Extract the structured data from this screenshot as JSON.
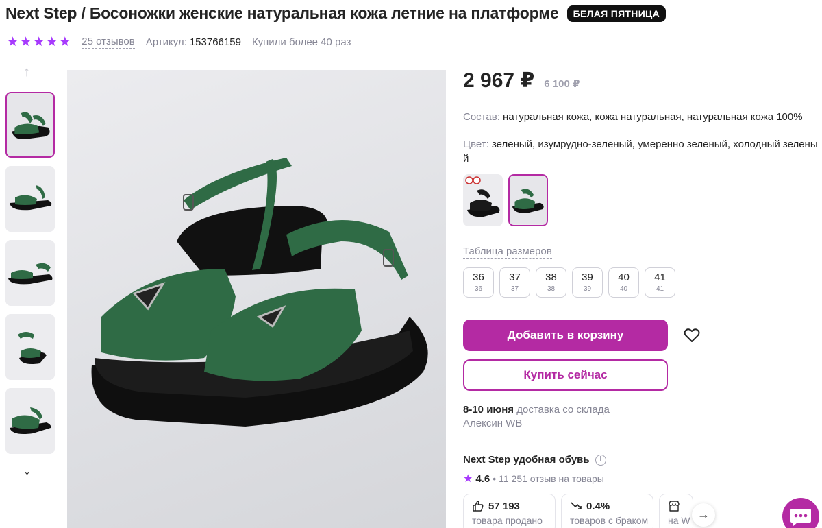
{
  "product": {
    "title": "Next Step / Босоножки женские натуральная кожа летние на платформе",
    "badge": "БЕЛАЯ ПЯТНИЦА",
    "rating_stars": 5,
    "reviews": "25 отзывов",
    "article_label": "Артикул:",
    "article_value": "153766159",
    "bought": "Купили более 40 раз"
  },
  "gallery": {
    "thumb_count": 5,
    "active_index": 0
  },
  "price": {
    "current": "2 967 ₽",
    "old": "6 100 ₽"
  },
  "composition": {
    "label": "Состав:",
    "value": "натуральная кожа, кожа натуральная, натуральная кожа 100%"
  },
  "color": {
    "label": "Цвет:",
    "value_line1": "зеленый, изумрудно-зеленый, умеренно зеленый, холодный зелены",
    "value_line2": "й"
  },
  "size_table_link": "Таблица размеров",
  "sizes": [
    {
      "ru": "36",
      "eu": "36"
    },
    {
      "ru": "37",
      "eu": "37"
    },
    {
      "ru": "38",
      "eu": "38"
    },
    {
      "ru": "39",
      "eu": "39"
    },
    {
      "ru": "40",
      "eu": "40"
    },
    {
      "ru": "41",
      "eu": "41"
    }
  ],
  "buttons": {
    "add_to_cart": "Добавить в корзину",
    "buy_now": "Купить сейчас"
  },
  "delivery": {
    "dates": "8-10 июня",
    "text": "доставка со склада",
    "warehouse": "Алексин WB"
  },
  "seller": {
    "name": "Next Step удобная обувь",
    "rating": "4.6",
    "reviews": "11 251 отзыв на товары"
  },
  "stats": [
    {
      "value": "57 193",
      "label": "товара продано",
      "icon": "thumbs-up-icon"
    },
    {
      "value": "0.4%",
      "label": "товаров с браком",
      "icon": "trend-down-icon"
    },
    {
      "value": "",
      "label": "на W",
      "icon": "store-icon"
    }
  ],
  "colors": {
    "accent": "#b42aa3",
    "star": "#a73afd",
    "text": "#242424",
    "muted": "#868695"
  }
}
